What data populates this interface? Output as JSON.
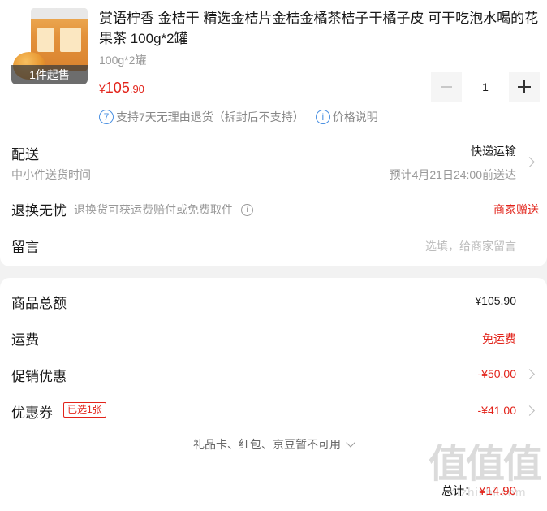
{
  "product": {
    "badge": "1件起售",
    "title": "赏语柠香 金桔干 精选金桔片金桔金橘茶桔子干橘子皮 可干吃泡水喝的花果茶 100g*2罐",
    "spec": "100g*2罐",
    "price": {
      "symbol": "¥",
      "integer": "105",
      "decimal": ".90"
    },
    "quantity": "1",
    "return_num": "7",
    "return_policy": "支持7天无理由退货（拆封后不支持）",
    "info_icon_text": "i",
    "price_note": "价格说明"
  },
  "delivery": {
    "label": "配送",
    "sub": "中小件送货时间",
    "method": "快递运输",
    "eta": "预计4月21日24:00前送达"
  },
  "returns": {
    "label": "退换无忧",
    "desc": "退换货可获运费赔付或免费取件",
    "info": "i",
    "right": "商家赠送"
  },
  "message": {
    "label": "留言",
    "placeholder": "选填，给商家留言"
  },
  "summary": {
    "goods_total_label": "商品总额",
    "goods_total": "¥105.90",
    "shipping_label": "运费",
    "shipping_value": "免运费",
    "promo_label": "促销优惠",
    "promo_value": "-¥50.00",
    "coupon_label": "优惠券",
    "coupon_tag": "已选1张",
    "coupon_value": "-¥41.00",
    "gift_card_note": "礼品卡、红包、京豆暂不可用",
    "total_label": "总计：",
    "total_value": "¥14.90"
  },
  "watermark": {
    "big": "值值值",
    "small": "zhizhizhi.com"
  },
  "colors": {
    "accent_red": "#e2231a",
    "info_blue": "#4a90e2",
    "background": "#f2f2f2"
  }
}
